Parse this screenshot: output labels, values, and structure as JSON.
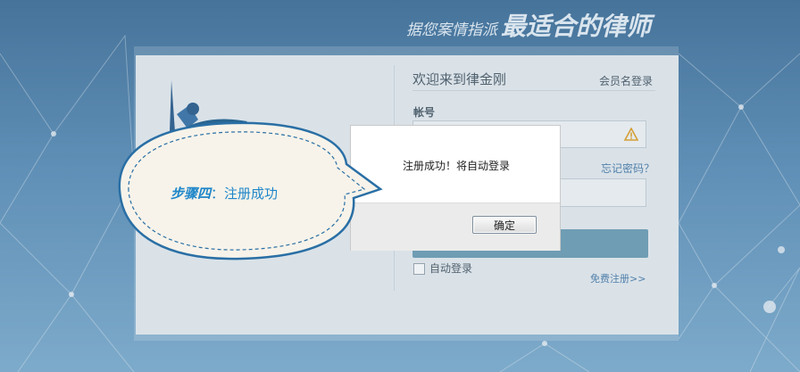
{
  "header": {
    "slogan_small": "据您案情指派",
    "slogan_big": "最适合的律师"
  },
  "login": {
    "welcome": "欢迎来到律金刚",
    "member_login": "会员名登录",
    "account_label": "帐号",
    "forgot_password": "忘记密码？",
    "auto_login": "自动登录",
    "register": "免费注册>>"
  },
  "dialog": {
    "message": "注册成功！将自动登录",
    "ok_label": "确定"
  },
  "callout": {
    "step": "步骤四",
    "separator": "：",
    "text": "注册成功"
  },
  "colors": {
    "accent": "#1e86c9",
    "link": "#4c7eaa",
    "button": "#6e9fb6",
    "warning": "#e2a227"
  },
  "icons": {
    "warning": "warning-icon"
  }
}
